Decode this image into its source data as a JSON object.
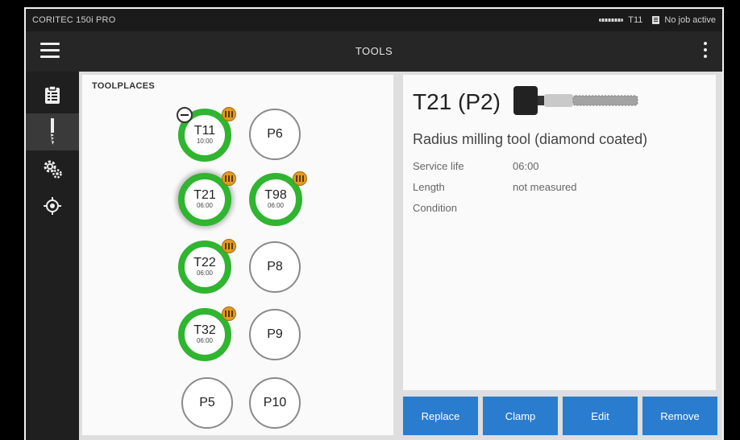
{
  "status_bar": {
    "app_name": "CORITEC 150i PRO",
    "current_tool": "T11",
    "job_status": "No job active"
  },
  "top_bar": {
    "title": "TOOLS"
  },
  "sidebar": {
    "items": [
      {
        "name": "clipboard-icon",
        "active": false
      },
      {
        "name": "milling-tool-icon",
        "active": true
      },
      {
        "name": "settings-gear-icon",
        "active": false
      },
      {
        "name": "target-crosshair-icon",
        "active": false
      }
    ]
  },
  "toolplaces": {
    "header": "TOOLPLACES",
    "slots": [
      {
        "label": "T11",
        "time": "10:00",
        "kind": "tool",
        "badge": true,
        "remove_marker": true
      },
      {
        "label": "P6",
        "time": "",
        "kind": "empty"
      },
      {
        "label": "T21",
        "time": "06:00",
        "kind": "tool",
        "badge": true,
        "selected": true
      },
      {
        "label": "T98",
        "time": "06:00",
        "kind": "tool",
        "badge": true
      },
      {
        "label": "T22",
        "time": "06:00",
        "kind": "tool",
        "badge": true
      },
      {
        "label": "P8",
        "time": "",
        "kind": "empty"
      },
      {
        "label": "T32",
        "time": "06:00",
        "kind": "tool",
        "badge": true
      },
      {
        "label": "P9",
        "time": "",
        "kind": "empty"
      },
      {
        "label": "P5",
        "time": "",
        "kind": "empty"
      },
      {
        "label": "P10",
        "time": "",
        "kind": "empty"
      }
    ]
  },
  "detail": {
    "title": "T21 (P2)",
    "description": "Radius milling tool (diamond coated)",
    "properties": [
      {
        "label": "Service life",
        "value": "06:00"
      },
      {
        "label": "Length",
        "value": "not measured"
      },
      {
        "label": "Condition",
        "value": ""
      }
    ]
  },
  "actions": {
    "replace": "Replace",
    "clamp": "Clamp",
    "edit": "Edit",
    "remove": "Remove"
  },
  "colors": {
    "tool_ring": "#2fb52f",
    "button": "#2a7ccf",
    "badge": "#e39a22",
    "dark_bg": "#1b1b1b"
  }
}
